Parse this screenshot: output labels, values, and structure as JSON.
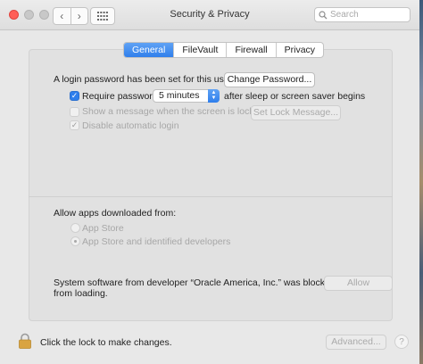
{
  "window": {
    "title": "Security & Privacy"
  },
  "toolbar": {
    "back_glyph": "‹",
    "forward_glyph": "›"
  },
  "search": {
    "placeholder": "Search",
    "value": ""
  },
  "tabs": [
    {
      "label": "General",
      "active": true
    },
    {
      "label": "FileVault",
      "active": false
    },
    {
      "label": "Firewall",
      "active": false
    },
    {
      "label": "Privacy",
      "active": false
    }
  ],
  "general": {
    "login_password_text": "A login password has been set for this user",
    "change_password_label": "Change Password...",
    "require_password": {
      "label": "Require password",
      "checked": true
    },
    "require_interval": {
      "value": "5 minutes"
    },
    "after_sleep_text": "after sleep or screen saver begins",
    "show_message": {
      "label": "Show a message when the screen is locked",
      "checked": false,
      "enabled": false
    },
    "set_lock_message_label": "Set Lock Message...",
    "disable_auto_login": {
      "label": "Disable automatic login",
      "checked": true,
      "enabled": false
    }
  },
  "downloads": {
    "heading": "Allow apps downloaded from:",
    "options": [
      {
        "label": "App Store",
        "selected": false
      },
      {
        "label": "App Store and identified developers",
        "selected": true
      }
    ]
  },
  "blocked": {
    "message_line1": "System software from developer “Oracle America, Inc.” was blocked",
    "message_line2": "from loading.",
    "allow_label": "Allow"
  },
  "footer": {
    "lock_text": "Click the lock to make changes.",
    "advanced_label": "Advanced...",
    "help_glyph": "?"
  },
  "colors": {
    "accent": "#2f7fec",
    "lock_gold": "#d9a441"
  }
}
